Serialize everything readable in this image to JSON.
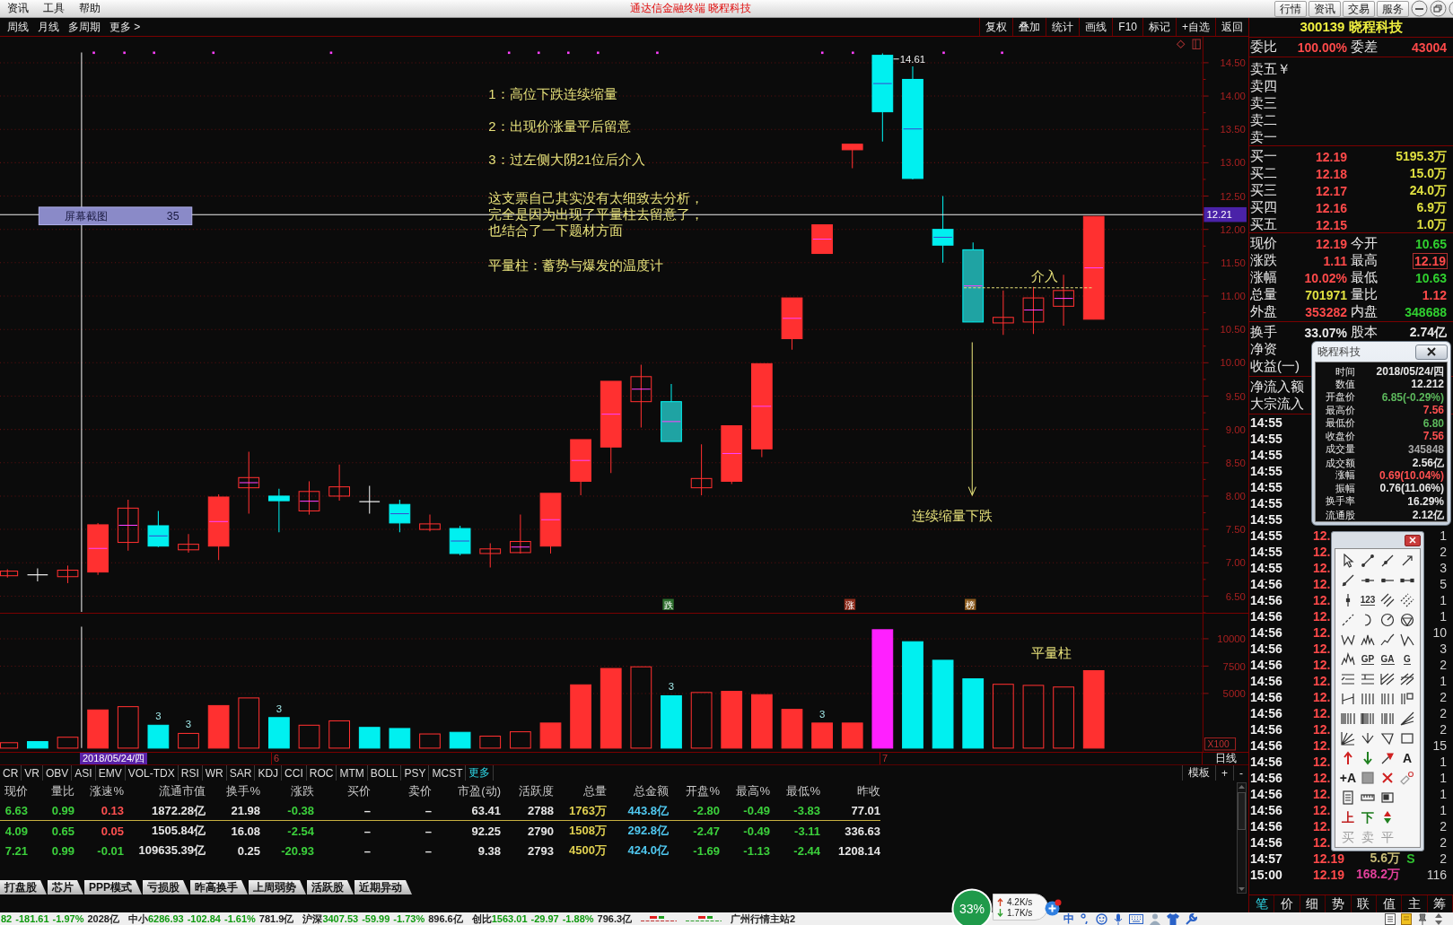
{
  "menubar": {
    "menus": [
      "资讯",
      "工具",
      "帮助"
    ],
    "title": "通达信金融终端 晓程科技",
    "buttons": [
      "行情",
      "资讯",
      "交易",
      "服务"
    ]
  },
  "toolbar": {
    "periods": [
      "周线",
      "月线",
      "多周期",
      "更多 >"
    ],
    "tools": [
      "复权",
      "叠加",
      "统计",
      "画线",
      "F10",
      "标记",
      "+自选",
      "返回"
    ]
  },
  "price_chart": {
    "axis_labels": [
      "14.50",
      "14.00",
      "13.50",
      "13.00",
      "12.50",
      "12.00",
      "11.50",
      "11.00",
      "10.50",
      "10.00",
      "9.50",
      "9.00",
      "8.50",
      "8.00",
      "7.50",
      "7.00",
      "6.50"
    ],
    "price_tag": "12.21",
    "peak_label": "14.61",
    "tooltip": {
      "label": "屏幕截图",
      "value": "35"
    },
    "notes": [
      "1：高位下跌连续缩量",
      "2：出现价涨量平后留意",
      "3：过左侧大阴21位后介入",
      "这支票自己其实没有太细致去分析，完全是因为出现了平量柱去留意了，也结合了一下题材方面",
      "平量柱：蓄势与爆发的温度计"
    ],
    "entry_label": "介入",
    "arrow_label": "连续缩量下跌",
    "badges": [
      {
        "text": "跌",
        "kind": "down"
      },
      {
        "text": "涨",
        "kind": "up"
      },
      {
        "text": "榜",
        "kind": "list"
      }
    ]
  },
  "volume_chart": {
    "axis_labels": [
      "10000",
      "7500",
      "5000"
    ],
    "unit": "X100",
    "bar_labels": [
      "3",
      "3",
      "3",
      "3",
      "3"
    ],
    "note": "平量柱"
  },
  "date_bar": {
    "date": "2018/05/24/四",
    "month_marks": [
      "6",
      "7"
    ],
    "period": "日线"
  },
  "indicator_tabs": {
    "tabs": [
      {
        "label": "CR",
        "kind": "indicator"
      },
      {
        "label": "VR",
        "kind": "indicator"
      },
      {
        "label": "OBV",
        "kind": "indicator"
      },
      {
        "label": "ASI",
        "kind": "indicator"
      },
      {
        "label": "EMV",
        "kind": "indicator"
      },
      {
        "label": "VOL-TDX",
        "kind": "indicator"
      },
      {
        "label": "RSI",
        "kind": "indicator"
      },
      {
        "label": "WR",
        "kind": "indicator"
      },
      {
        "label": "SAR",
        "kind": "indicator"
      },
      {
        "label": "KDJ",
        "kind": "indicator"
      },
      {
        "label": "CCI",
        "kind": "indicator"
      },
      {
        "label": "ROC",
        "kind": "indicator"
      },
      {
        "label": "MTM",
        "kind": "indicator"
      },
      {
        "label": "BOLL",
        "kind": "indicator"
      },
      {
        "label": "PSY",
        "kind": "indicator"
      },
      {
        "label": "MCST",
        "kind": "indicator"
      },
      {
        "label": "更多",
        "kind": "more"
      }
    ],
    "actions": [
      "模板",
      "+",
      "-"
    ]
  },
  "quote_table": {
    "columns": [
      "现价",
      "量比",
      "涨速%",
      "流通市值",
      "换手%",
      "涨跌",
      "买价",
      "卖价",
      "市盈(动)",
      "活跃度",
      "总量",
      "总金额",
      "开盘%",
      "最高%",
      "最低%",
      "昨收"
    ],
    "rows": [
      {
        "selected": true,
        "cells": [
          {
            "text": "6.63",
            "color": "#3cd03c"
          },
          {
            "text": "0.99",
            "color": "#3cd03c"
          },
          {
            "text": "0.13",
            "color": "#ff5050"
          },
          {
            "text": "1872.28亿",
            "color": "#e6e6e6"
          },
          {
            "text": "21.98",
            "color": "#e6e6e6"
          },
          {
            "text": "-0.38",
            "color": "#3cd03c"
          },
          {
            "text": "–"
          },
          {
            "text": "–"
          },
          {
            "text": "63.41",
            "color": "#e6e6e6"
          },
          {
            "text": "2788",
            "color": "#e6e6e6"
          },
          {
            "text": "1763万",
            "color": "#e0d050"
          },
          {
            "text": "443.8亿",
            "color": "#50c8f0"
          },
          {
            "text": "-2.80",
            "color": "#3cd03c"
          },
          {
            "text": "-0.49",
            "color": "#3cd03c"
          },
          {
            "text": "-3.83",
            "color": "#3cd03c"
          },
          {
            "text": "77.01",
            "color": "#e6e6e6"
          }
        ]
      },
      {
        "selected": false,
        "cells": [
          {
            "text": "4.09",
            "color": "#3cd03c"
          },
          {
            "text": "0.65",
            "color": "#3cd03c"
          },
          {
            "text": "0.05",
            "color": "#ff5050"
          },
          {
            "text": "1505.84亿",
            "color": "#e6e6e6"
          },
          {
            "text": "16.08",
            "color": "#e6e6e6"
          },
          {
            "text": "-2.54",
            "color": "#3cd03c"
          },
          {
            "text": "–"
          },
          {
            "text": "–"
          },
          {
            "text": "92.25",
            "color": "#e6e6e6"
          },
          {
            "text": "2790",
            "color": "#e6e6e6"
          },
          {
            "text": "1508万",
            "color": "#e0d050"
          },
          {
            "text": "292.8亿",
            "color": "#50c8f0"
          },
          {
            "text": "-2.47",
            "color": "#3cd03c"
          },
          {
            "text": "-0.49",
            "color": "#3cd03c"
          },
          {
            "text": "-3.11",
            "color": "#3cd03c"
          },
          {
            "text": "336.63",
            "color": "#e6e6e6"
          }
        ]
      },
      {
        "selected": false,
        "cells": [
          {
            "text": "7.21",
            "color": "#3cd03c"
          },
          {
            "text": "0.99",
            "color": "#3cd03c"
          },
          {
            "text": "-0.01",
            "color": "#3cd03c"
          },
          {
            "text": "109635.39亿",
            "color": "#e6e6e6"
          },
          {
            "text": "0.25",
            "color": "#e6e6e6"
          },
          {
            "text": "-20.93",
            "color": "#3cd03c"
          },
          {
            "text": "–"
          },
          {
            "text": "–"
          },
          {
            "text": "9.38",
            "color": "#e6e6e6"
          },
          {
            "text": "2793",
            "color": "#e6e6e6"
          },
          {
            "text": "4500万",
            "color": "#e0d050"
          },
          {
            "text": "424.0亿",
            "color": "#50c8f0"
          },
          {
            "text": "-1.69",
            "color": "#3cd03c"
          },
          {
            "text": "-1.13",
            "color": "#3cd03c"
          },
          {
            "text": "-2.44",
            "color": "#3cd03c"
          },
          {
            "text": "1208.14",
            "color": "#e6e6e6"
          }
        ]
      }
    ]
  },
  "sector_tabs": [
    "打盘股",
    "芯片",
    "PPP模式",
    "亏损股",
    "昨高换手",
    "上周弱势",
    "活跃股",
    "近期异动"
  ],
  "status_bar": {
    "indices": [
      {
        "value": "82",
        "change": "-181.61",
        "percent": "-1.97%",
        "amount": "2028亿"
      },
      {
        "name": "中小",
        "value": "6286.93",
        "change": "-102.84",
        "percent": "-1.61%",
        "amount": "781.9亿"
      },
      {
        "name": "沪深",
        "value": "3407.53",
        "change": "-59.99",
        "percent": "-1.73%",
        "amount": "896.6亿"
      },
      {
        "name": "创比",
        "value": "1563.01",
        "change": "-29.97",
        "percent": "-1.88%",
        "amount": "796.3亿"
      }
    ],
    "server": "广州行情主站2",
    "input_method": "中"
  },
  "quote_panel": {
    "title": "300139 晓程科技",
    "ratio": [
      {
        "label": "委比",
        "value": "100.00%"
      },
      {
        "label": "委差",
        "value": "43004"
      }
    ],
    "asks": [
      "卖五￥",
      "卖四",
      "卖三",
      "卖二",
      "卖一"
    ],
    "bids": [
      {
        "label": "买一",
        "price": "12.19",
        "volume": "5195.3万"
      },
      {
        "label": "买二",
        "price": "12.18",
        "volume": "15.0万"
      },
      {
        "label": "买三",
        "price": "12.17",
        "volume": "24.0万"
      },
      {
        "label": "买四",
        "price": "12.16",
        "volume": "6.9万"
      },
      {
        "label": "买五",
        "price": "12.15",
        "volume": "1.0万"
      }
    ],
    "stats": [
      {
        "label": "现价",
        "value": "12.19",
        "color": "#ff4a4a",
        "highlighted": false
      },
      {
        "label": "今开",
        "value": "10.65",
        "color": "#30d030",
        "highlighted": false
      },
      {
        "label": "涨跌",
        "value": "1.11",
        "color": "#ff4a4a",
        "highlighted": false
      },
      {
        "label": "最高",
        "value": "12.19",
        "color": "#ff4a4a",
        "highlighted": true
      },
      {
        "label": "涨幅",
        "value": "10.02%",
        "color": "#ff4a4a",
        "highlighted": false
      },
      {
        "label": "最低",
        "value": "10.63",
        "color": "#30d030",
        "highlighted": false
      },
      {
        "label": "总量",
        "value": "701971",
        "color": "#e0e040",
        "highlighted": false
      },
      {
        "label": "量比",
        "value": "1.12",
        "color": "#ff4a4a",
        "highlighted": false
      },
      {
        "label": "外盘",
        "value": "353282",
        "color": "#ff4a4a",
        "highlighted": false
      },
      {
        "label": "内盘",
        "value": "348688",
        "color": "#30d030",
        "highlighted": false
      }
    ],
    "extra": [
      {
        "label": "换手",
        "value": "33.07%"
      },
      {
        "label": "股本",
        "value": "2.74亿"
      }
    ],
    "labels": [
      "净资",
      "收益(一)",
      "净流入额",
      "大宗流入"
    ],
    "trades": [
      {
        "time": "14:55"
      },
      {
        "time": "14:55"
      },
      {
        "time": "14:55"
      },
      {
        "time": "14:55"
      },
      {
        "time": "14:55"
      },
      {
        "time": "14:55"
      },
      {
        "time": "14:55"
      },
      {
        "time": "14:55",
        "price": "12.",
        "count": "1"
      },
      {
        "time": "14:55",
        "price": "12.",
        "count": "2"
      },
      {
        "time": "14:55",
        "price": "12.",
        "count": "3"
      },
      {
        "time": "14:56",
        "price": "12.",
        "count": "5"
      },
      {
        "time": "14:56",
        "price": "12.",
        "count": "1"
      },
      {
        "time": "14:56",
        "price": "12.",
        "count": "1"
      },
      {
        "time": "14:56",
        "price": "12.",
        "count": "10"
      },
      {
        "time": "14:56",
        "price": "12.",
        "count": "3"
      },
      {
        "time": "14:56",
        "price": "12.",
        "count": "2"
      },
      {
        "time": "14:56",
        "price": "12.",
        "count": "1"
      },
      {
        "time": "14:56",
        "price": "12.",
        "count": "2"
      },
      {
        "time": "14:56",
        "price": "12.",
        "count": "2"
      },
      {
        "time": "14:56",
        "price": "12.",
        "count": "2"
      },
      {
        "time": "14:56",
        "price": "12.",
        "count": "15"
      },
      {
        "time": "14:56",
        "price": "12.",
        "count": "1"
      },
      {
        "time": "14:56",
        "price": "12.",
        "count": "1"
      },
      {
        "time": "14:56",
        "price": "12.",
        "count": "1"
      },
      {
        "time": "14:56",
        "price": "12.",
        "count": "1"
      },
      {
        "time": "14:56",
        "price": "12.",
        "count": "2"
      },
      {
        "time": "14:56",
        "price": "12.",
        "count": "2"
      },
      {
        "time": "14:57",
        "price": "12.19",
        "volume": "5.6万",
        "color": "#c8bc78",
        "side": "S",
        "count": "2"
      },
      {
        "time": "15:00",
        "price": "12.19",
        "volume": "168.2万",
        "color": "#e0409a",
        "count": "116"
      }
    ],
    "tabs": [
      {
        "label": "笔",
        "selected": true
      },
      {
        "label": "价",
        "selected": false
      },
      {
        "label": "细",
        "selected": false
      },
      {
        "label": "势",
        "selected": false
      },
      {
        "label": "联",
        "selected": false
      },
      {
        "label": "值",
        "selected": false
      },
      {
        "label": "主",
        "selected": false
      },
      {
        "label": "筹",
        "selected": false
      }
    ]
  },
  "data_popup": {
    "title": "晓程科技",
    "rows": [
      {
        "label": "时间",
        "value": "2018/05/24/四",
        "color": "#e6e6e6"
      },
      {
        "label": "数值",
        "value": "12.212",
        "color": "#e6e6e6"
      },
      {
        "label": "开盘价",
        "value": "6.85(-0.29%)",
        "color": "#5cb85c"
      },
      {
        "label": "最高价",
        "value": "7.56",
        "color": "#ff5050"
      },
      {
        "label": "最低价",
        "value": "6.80",
        "color": "#5cb85c"
      },
      {
        "label": "收盘价",
        "value": "7.56",
        "color": "#ff5050"
      },
      {
        "label": "成交量",
        "value": "345848",
        "color": "#a8a8a8"
      },
      {
        "label": "成交额",
        "value": "2.56亿",
        "color": "#e6e6e6"
      },
      {
        "label": "涨幅",
        "value": "0.69(10.04%)",
        "color": "#ff5050"
      },
      {
        "label": "振幅",
        "value": "0.76(11.06%)",
        "color": "#e6e6e6"
      },
      {
        "label": "换手率",
        "value": "16.29%",
        "color": "#e6e6e6"
      },
      {
        "label": "流通股",
        "value": "2.12亿",
        "color": "#e6e6e6"
      }
    ]
  },
  "drawing_palette": {
    "rows": [
      [
        {
          "kind": "icon",
          "disabled": false
        },
        {
          "kind": "icon",
          "disabled": false
        },
        {
          "kind": "icon",
          "disabled": false
        },
        {
          "kind": "icon",
          "disabled": false
        }
      ],
      [
        {
          "kind": "icon",
          "disabled": false
        },
        {
          "kind": "icon",
          "disabled": false
        },
        {
          "kind": "icon",
          "disabled": false
        },
        {
          "kind": "icon",
          "disabled": false
        }
      ],
      [
        {
          "kind": "icon",
          "disabled": false
        },
        {
          "kind": "label",
          "label": "123",
          "color": "#303030",
          "disabled": false
        },
        {
          "kind": "icon",
          "disabled": false
        },
        {
          "kind": "icon",
          "disabled": false
        }
      ],
      [
        {
          "kind": "icon",
          "disabled": false
        },
        {
          "kind": "icon",
          "disabled": false
        },
        {
          "kind": "icon",
          "disabled": false
        },
        {
          "kind": "icon",
          "disabled": false
        }
      ],
      [
        {
          "kind": "icon",
          "disabled": false
        },
        {
          "kind": "icon",
          "disabled": false
        },
        {
          "kind": "icon",
          "disabled": false
        },
        {
          "kind": "icon",
          "disabled": false
        }
      ],
      [
        {
          "kind": "icon",
          "disabled": false
        },
        {
          "kind": "label",
          "label": "GP",
          "color": "#303030",
          "disabled": false
        },
        {
          "kind": "label",
          "label": "GA",
          "color": "#303030",
          "disabled": false
        },
        {
          "kind": "label",
          "label": "G",
          "color": "#303030",
          "disabled": false
        }
      ],
      [
        {
          "kind": "icon",
          "disabled": false
        },
        {
          "kind": "icon",
          "disabled": false
        },
        {
          "kind": "icon",
          "disabled": false
        },
        {
          "kind": "icon",
          "disabled": false
        }
      ],
      [
        {
          "kind": "icon",
          "disabled": false
        },
        {
          "kind": "icon",
          "disabled": false
        },
        {
          "kind": "icon",
          "disabled": false
        },
        {
          "kind": "icon",
          "disabled": false
        }
      ],
      [
        {
          "kind": "icon",
          "disabled": false
        },
        {
          "kind": "icon",
          "disabled": false
        },
        {
          "kind": "icon",
          "disabled": false
        },
        {
          "kind": "icon",
          "disabled": false
        }
      ],
      [
        {
          "kind": "icon",
          "disabled": false
        },
        {
          "kind": "icon",
          "disabled": false
        },
        {
          "kind": "icon",
          "disabled": false
        },
        {
          "kind": "icon",
          "disabled": false
        }
      ],
      [
        {
          "kind": "icon",
          "disabled": false
        },
        {
          "kind": "icon",
          "disabled": false
        },
        {
          "kind": "icon",
          "disabled": false
        },
        {
          "kind": "text",
          "label": "A",
          "color": "#202020",
          "disabled": false
        }
      ],
      [
        {
          "kind": "text",
          "label": "+A",
          "color": "#202020",
          "disabled": false
        },
        {
          "kind": "icon",
          "disabled": false
        },
        {
          "kind": "icon",
          "disabled": false
        },
        {
          "kind": "icon",
          "disabled": false
        }
      ],
      [
        {
          "kind": "icon",
          "disabled": false
        },
        {
          "kind": "icon",
          "disabled": false
        },
        {
          "kind": "icon",
          "disabled": false
        }
      ],
      [
        {
          "kind": "text",
          "label": "上",
          "color": "#c02020",
          "disabled": false
        },
        {
          "kind": "text",
          "label": "下",
          "color": "#1a7a1a",
          "disabled": false
        },
        {
          "kind": "icon",
          "disabled": false
        }
      ],
      [
        {
          "kind": "text",
          "label": "买",
          "color": "#a0a0a0",
          "disabled": true
        },
        {
          "kind": "text",
          "label": "卖",
          "color": "#a0a0a0",
          "disabled": true
        },
        {
          "kind": "text",
          "label": "平",
          "color": "#a0a0a0",
          "disabled": true
        }
      ]
    ]
  },
  "network_widget": {
    "load": "33%",
    "upload": "4.2K/s",
    "download": "1.7K/s"
  }
}
